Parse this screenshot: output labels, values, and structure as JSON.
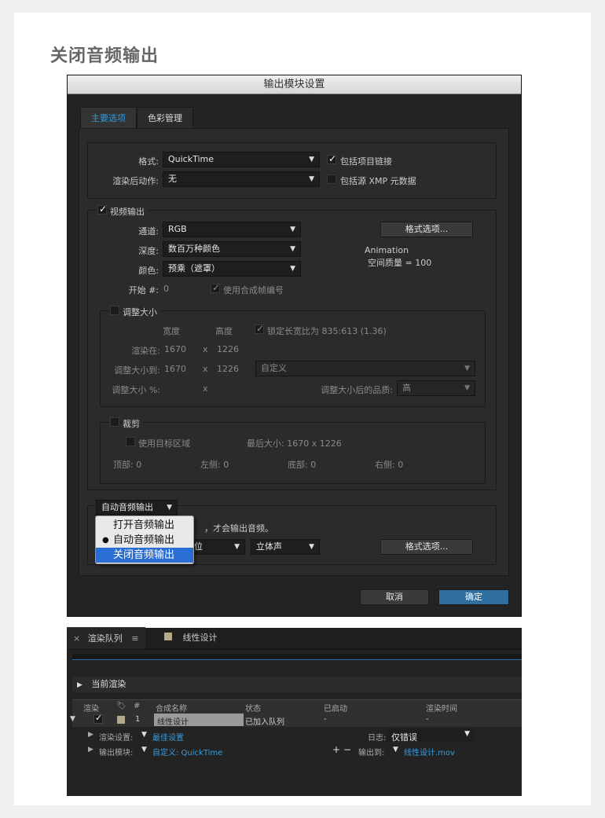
{
  "page": {
    "title": "关闭音频输出"
  },
  "dialog": {
    "title": "输出模块设置",
    "tabs": [
      "主要选项",
      "色彩管理"
    ],
    "format": {
      "label": "格式:",
      "value": "QuickTime"
    },
    "post_render": {
      "label": "渲染后动作:",
      "value": "无"
    },
    "include_project_link": {
      "label": "包括项目链接",
      "checked": true
    },
    "include_xmp": {
      "label": "包括源 XMP 元数据",
      "checked": false
    },
    "video_output": {
      "label": "视频输出",
      "checked": true,
      "channels": {
        "label": "通道:",
        "value": "RGB"
      },
      "depth": {
        "label": "深度:",
        "value": "数百万种颜色"
      },
      "color": {
        "label": "颜色:",
        "value": "预乘（遮罩）"
      },
      "start": {
        "label": "开始 #:",
        "value": "0"
      },
      "use_comp_frame": {
        "label": "使用合成帧编号",
        "checked": true
      },
      "format_options_button": "格式选项...",
      "codec_info_line1": "Animation",
      "codec_info_line2": "空间质量 = 100"
    },
    "resize": {
      "label": "调整大小",
      "checked": false,
      "width_header": "宽度",
      "height_header": "高度",
      "lock_aspect": {
        "label": "锁定长宽比为 835:613 (1.36)",
        "checked": true
      },
      "render_at": {
        "label": "渲染在:",
        "w": "1670",
        "x": "x",
        "h": "1226"
      },
      "resize_to": {
        "label": "调整大小到:",
        "w": "1670",
        "x": "x",
        "h": "1226",
        "preset": "自定义"
      },
      "resize_pct": {
        "label": "调整大小 %:",
        "x": "x"
      },
      "quality": {
        "label": "调整大小后的品质:",
        "value": "高"
      }
    },
    "crop": {
      "label": "裁剪",
      "checked": false,
      "use_roi": {
        "label": "使用目标区域",
        "checked": false
      },
      "final_size": "最后大小: 1670 x 1226",
      "top": "顶部:  0",
      "left": "左侧:  0",
      "bottom": "底部:  0",
      "right": "右侧:  0"
    },
    "audio": {
      "dropdown_value": "自动音频输出",
      "note": "，才会输出音频。",
      "bits_suffix": "位",
      "channel_value": "立体声",
      "format_options_button": "格式选项..."
    },
    "audio_menu": {
      "items": [
        "打开音频输出",
        "自动音频输出",
        "关闭音频输出"
      ],
      "checked_index": 1,
      "highlighted_index": 2
    },
    "cancel_button": "取消",
    "ok_button": "确定"
  },
  "render_queue": {
    "close_glyph": "×",
    "tab_label": "渲染队列",
    "menu_glyph": "≡",
    "comp_tab_label": "线性设计",
    "current_render": "当前渲染",
    "columns": [
      "渲染",
      "#",
      "合成名称",
      "状态",
      "已启动",
      "渲染时间"
    ],
    "row": {
      "index": "1",
      "comp_name": "线性设计",
      "status": "已加入队列",
      "started": "-",
      "render_time": "-"
    },
    "render_settings": {
      "label": "渲染设置:",
      "value": "最佳设置"
    },
    "log": {
      "label": "日志:",
      "value": "仅错误"
    },
    "output_module": {
      "label": "输出模块:",
      "value": "自定义: QuickTime"
    },
    "output_to": {
      "label": "输出到:",
      "value": "线性设计.mov"
    },
    "plus_glyph": "+",
    "minus_glyph": "−"
  },
  "colors": {
    "accent_blue": "#2d9be0",
    "ok_button": "#2e6fa0",
    "menu_highlight": "#2a6ed4",
    "panel_bg": "#2b2b2b",
    "label_swatch": "#b5a88d"
  }
}
